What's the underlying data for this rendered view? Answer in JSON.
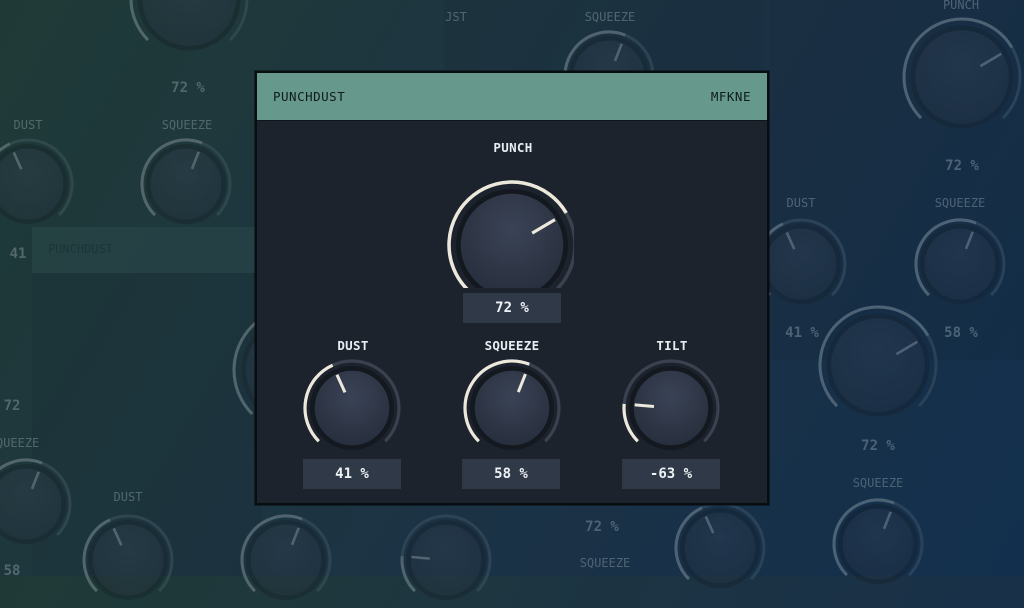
{
  "background": {
    "panels": [
      {
        "label": "PUNCHDUST"
      }
    ],
    "labels": [
      "DUST",
      "SQUEEZE",
      "JST",
      "SQUEEZE",
      "PUNCH",
      "DUST",
      "SQUEEZE",
      "DUST",
      "SQUEEZE",
      "SQUEEZE",
      "SQUEEZE"
    ],
    "values": [
      "72 %",
      "41",
      "72",
      "72 %",
      "41 %",
      "58 %",
      "72 %",
      "72 %",
      "58"
    ]
  },
  "plugin": {
    "name": "PUNCHDUST",
    "brand": "MFKNE",
    "colors": {
      "header": "#66998c",
      "panel": "#1c232d",
      "knob_body": "#2e3646",
      "arc_active": "#ece8dc",
      "arc_track": "#3a4250",
      "value_box": "#2f3947"
    },
    "knobs": {
      "punch": {
        "label": "PUNCH",
        "value_text": "72 %",
        "value": 0.72
      },
      "dust": {
        "label": "DUST",
        "value_text": "41 %",
        "value": 0.41
      },
      "squeeze": {
        "label": "SQUEEZE",
        "value_text": "58 %",
        "value": 0.58
      },
      "tilt": {
        "label": "TILT",
        "value_text": "-63 %",
        "value": 0.185
      }
    }
  }
}
